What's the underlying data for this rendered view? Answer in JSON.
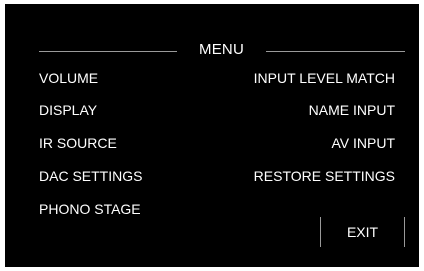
{
  "menu": {
    "title": "MENU",
    "left_items": [
      "VOLUME",
      "DISPLAY",
      "IR SOURCE",
      "DAC SETTINGS",
      "PHONO STAGE"
    ],
    "right_items": [
      "INPUT LEVEL MATCH",
      "NAME INPUT",
      "AV INPUT",
      "RESTORE SETTINGS"
    ],
    "exit_label": "EXIT"
  },
  "colors": {
    "background": "#000000",
    "text": "#ffffff",
    "rule": "#9a9a9a",
    "frame": "#ffffff"
  }
}
